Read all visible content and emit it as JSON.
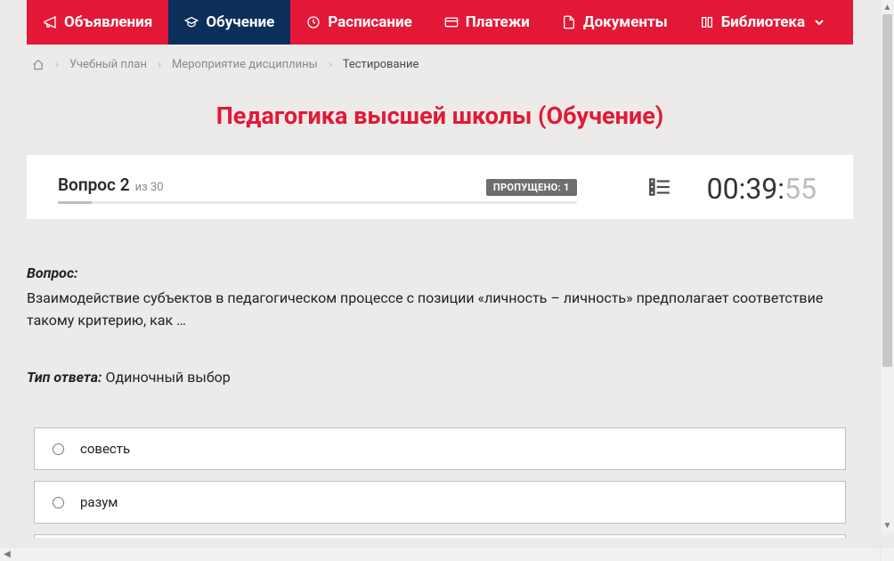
{
  "nav": {
    "items": [
      {
        "label": "Объявления",
        "icon": "announce-icon",
        "active": false,
        "hasDropdown": false
      },
      {
        "label": "Обучение",
        "icon": "education-icon",
        "active": true,
        "hasDropdown": false
      },
      {
        "label": "Расписание",
        "icon": "clock-icon",
        "active": false,
        "hasDropdown": false
      },
      {
        "label": "Платежи",
        "icon": "card-icon",
        "active": false,
        "hasDropdown": false
      },
      {
        "label": "Документы",
        "icon": "document-icon",
        "active": false,
        "hasDropdown": false
      },
      {
        "label": "Библиотека",
        "icon": "library-icon",
        "active": false,
        "hasDropdown": true
      }
    ]
  },
  "breadcrumb": {
    "items": [
      {
        "label": "Учебный план",
        "current": false
      },
      {
        "label": "Мероприятие дисциплины",
        "current": false
      },
      {
        "label": "Тестирование",
        "current": true
      }
    ]
  },
  "page": {
    "title": "Педагогика высшей школы (Обучение)"
  },
  "status": {
    "question_prefix": "Вопрос",
    "question_number": "2",
    "of_word": "из",
    "question_total": "30",
    "skipped_label": "ПРОПУЩЕНО: 1",
    "timer_main": "00:39:",
    "timer_seconds": "55"
  },
  "question": {
    "label": "Вопрос:",
    "text": "Взаимодействие субъектов в педагогическом процессе с позиции «личность – личность» предполагает соответствие такому критерию, как …",
    "answer_type_label": "Тип ответа:",
    "answer_type_value": "Одиночный выбор"
  },
  "options": [
    {
      "label": "совесть"
    },
    {
      "label": "разум"
    }
  ]
}
